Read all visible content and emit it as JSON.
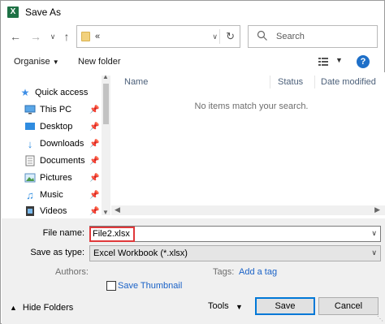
{
  "window": {
    "title": "Save As",
    "app_icon": "X"
  },
  "address_bar": {
    "path": "«",
    "search_placeholder": "Search"
  },
  "toolbar": {
    "organise_label": "Organise",
    "new_folder_label": "New folder"
  },
  "nav_pane": {
    "items": [
      {
        "label": "Quick access",
        "icon": "star-icon"
      },
      {
        "label": "This PC",
        "icon": "computer-icon"
      },
      {
        "label": "Desktop",
        "icon": "desktop-icon"
      },
      {
        "label": "Downloads",
        "icon": "download-icon"
      },
      {
        "label": "Documents",
        "icon": "documents-icon"
      },
      {
        "label": "Pictures",
        "icon": "pictures-icon"
      },
      {
        "label": "Music",
        "icon": "music-icon"
      },
      {
        "label": "Videos",
        "icon": "videos-icon"
      }
    ]
  },
  "file_list": {
    "columns": [
      "Name",
      "Status",
      "Date modified"
    ],
    "empty_message": "No items match your search."
  },
  "form": {
    "file_name_label": "File name:",
    "file_name_value": "File2.xlsx",
    "save_as_type_label": "Save as type:",
    "save_as_type_value": "Excel Workbook (*.xlsx)",
    "authors_label": "Authors:",
    "tags_label": "Tags:",
    "add_tag_label": "Add a tag",
    "save_thumbnail_label": "Save Thumbnail"
  },
  "footer": {
    "hide_folders_label": "Hide Folders",
    "tools_label": "Tools",
    "save_label": "Save",
    "cancel_label": "Cancel"
  },
  "colors": {
    "link": "#1a62c7",
    "highlight_border": "#e0383a",
    "excel_green": "#1e7145"
  }
}
